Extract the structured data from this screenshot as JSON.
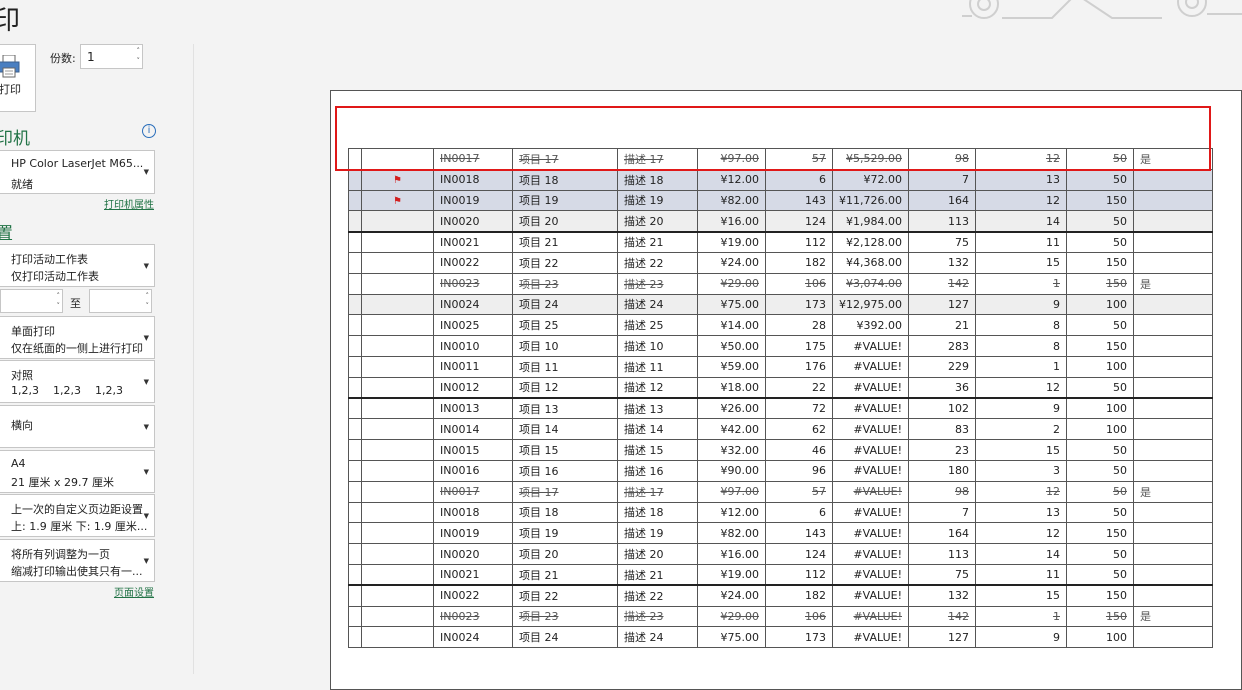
{
  "left": {
    "title": "印",
    "print_button": "打印",
    "copies_label": "份数:",
    "copies_value": "1",
    "printer_section": "印机",
    "printer_name": "HP Color LaserJet M65...",
    "printer_status": "就绪",
    "printer_props": "打印机属性",
    "settings_section": "置",
    "dd_scope_1": "打印活动工作表",
    "dd_scope_2": "仅打印活动工作表",
    "pages_to": "至",
    "dd_sides_1": "单面打印",
    "dd_sides_2": "仅在纸面的一侧上进行打印",
    "dd_collate_1": "对照",
    "dd_collate_2": "1,2,3    1,2,3    1,2,3",
    "dd_orient_1": "横向",
    "dd_paper_1": "A4",
    "dd_paper_2": "21 厘米 x 29.7 厘米",
    "dd_margin_1": "上一次的自定义页边距设置",
    "dd_margin_2": "上: 1.9 厘米 下: 1.9 厘米...",
    "dd_scale_1": "将所有列调整为一页",
    "dd_scale_2": "缩减打印输出使其只有一...",
    "page_setup": "页面设置"
  },
  "colors": {
    "accent": "#217346",
    "selection": "#d6dae6",
    "highlight_box": "#e01818",
    "flag": "#d21f1f"
  },
  "rows": [
    {
      "id": "IN0017",
      "name": "项目 17",
      "desc": "描述 17",
      "price": "¥97.00",
      "qty": "57",
      "total": "¥5,529.00",
      "c8": "98",
      "c9": "12",
      "c10": "50",
      "c11": "是",
      "style": "strike"
    },
    {
      "id": "IN0018",
      "name": "项目 18",
      "desc": "描述 18",
      "price": "¥12.00",
      "qty": "6",
      "total": "¥72.00",
      "c8": "7",
      "c9": "13",
      "c10": "50",
      "c11": "",
      "style": "sel",
      "flag": true
    },
    {
      "id": "IN0019",
      "name": "项目 19",
      "desc": "描述 19",
      "price": "¥82.00",
      "qty": "143",
      "total": "¥11,726.00",
      "c8": "164",
      "c9": "12",
      "c10": "150",
      "c11": "",
      "style": "sel",
      "flag": true
    },
    {
      "id": "IN0020",
      "name": "项目 20",
      "desc": "描述 20",
      "price": "¥16.00",
      "qty": "124",
      "total": "¥1,984.00",
      "c8": "113",
      "c9": "14",
      "c10": "50",
      "c11": "",
      "style": "gray"
    },
    {
      "id": "IN0021",
      "name": "项目 21",
      "desc": "描述 21",
      "price": "¥19.00",
      "qty": "112",
      "total": "¥2,128.00",
      "c8": "75",
      "c9": "11",
      "c10": "50",
      "c11": "",
      "style": "thick"
    },
    {
      "id": "IN0022",
      "name": "项目 22",
      "desc": "描述 22",
      "price": "¥24.00",
      "qty": "182",
      "total": "¥4,368.00",
      "c8": "132",
      "c9": "15",
      "c10": "150",
      "c11": "",
      "style": ""
    },
    {
      "id": "IN0023",
      "name": "项目 23",
      "desc": "描述 23",
      "price": "¥29.00",
      "qty": "106",
      "total": "¥3,074.00",
      "c8": "142",
      "c9": "1",
      "c10": "150",
      "c11": "是",
      "style": "strike"
    },
    {
      "id": "IN0024",
      "name": "项目 24",
      "desc": "描述 24",
      "price": "¥75.00",
      "qty": "173",
      "total": "¥12,975.00",
      "c8": "127",
      "c9": "9",
      "c10": "100",
      "c11": "",
      "style": "gray"
    },
    {
      "id": "IN0025",
      "name": "项目 25",
      "desc": "描述 25",
      "price": "¥14.00",
      "qty": "28",
      "total": "¥392.00",
      "c8": "21",
      "c9": "8",
      "c10": "50",
      "c11": "",
      "style": ""
    },
    {
      "id": "IN0010",
      "name": "项目 10",
      "desc": "描述 10",
      "price": "¥50.00",
      "qty": "175",
      "total": "#VALUE!",
      "c8": "283",
      "c9": "8",
      "c10": "150",
      "c11": "",
      "style": ""
    },
    {
      "id": "IN0011",
      "name": "项目 11",
      "desc": "描述 11",
      "price": "¥59.00",
      "qty": "176",
      "total": "#VALUE!",
      "c8": "229",
      "c9": "1",
      "c10": "100",
      "c11": "",
      "style": ""
    },
    {
      "id": "IN0012",
      "name": "项目 12",
      "desc": "描述 12",
      "price": "¥18.00",
      "qty": "22",
      "total": "#VALUE!",
      "c8": "36",
      "c9": "12",
      "c10": "50",
      "c11": "",
      "style": ""
    },
    {
      "id": "IN0013",
      "name": "项目 13",
      "desc": "描述 13",
      "price": "¥26.00",
      "qty": "72",
      "total": "#VALUE!",
      "c8": "102",
      "c9": "9",
      "c10": "100",
      "c11": "",
      "style": "thick"
    },
    {
      "id": "IN0014",
      "name": "项目 14",
      "desc": "描述 14",
      "price": "¥42.00",
      "qty": "62",
      "total": "#VALUE!",
      "c8": "83",
      "c9": "2",
      "c10": "100",
      "c11": "",
      "style": ""
    },
    {
      "id": "IN0015",
      "name": "项目 15",
      "desc": "描述 15",
      "price": "¥32.00",
      "qty": "46",
      "total": "#VALUE!",
      "c8": "23",
      "c9": "15",
      "c10": "50",
      "c11": "",
      "style": ""
    },
    {
      "id": "IN0016",
      "name": "项目 16",
      "desc": "描述 16",
      "price": "¥90.00",
      "qty": "96",
      "total": "#VALUE!",
      "c8": "180",
      "c9": "3",
      "c10": "50",
      "c11": "",
      "style": ""
    },
    {
      "id": "IN0017",
      "name": "项目 17",
      "desc": "描述 17",
      "price": "¥97.00",
      "qty": "57",
      "total": "#VALUE!",
      "c8": "98",
      "c9": "12",
      "c10": "50",
      "c11": "是",
      "style": "strike"
    },
    {
      "id": "IN0018",
      "name": "项目 18",
      "desc": "描述 18",
      "price": "¥12.00",
      "qty": "6",
      "total": "#VALUE!",
      "c8": "7",
      "c9": "13",
      "c10": "50",
      "c11": "",
      "style": ""
    },
    {
      "id": "IN0019",
      "name": "项目 19",
      "desc": "描述 19",
      "price": "¥82.00",
      "qty": "143",
      "total": "#VALUE!",
      "c8": "164",
      "c9": "12",
      "c10": "150",
      "c11": "",
      "style": ""
    },
    {
      "id": "IN0020",
      "name": "项目 20",
      "desc": "描述 20",
      "price": "¥16.00",
      "qty": "124",
      "total": "#VALUE!",
      "c8": "113",
      "c9": "14",
      "c10": "50",
      "c11": "",
      "style": ""
    },
    {
      "id": "IN0021",
      "name": "项目 21",
      "desc": "描述 21",
      "price": "¥19.00",
      "qty": "112",
      "total": "#VALUE!",
      "c8": "75",
      "c9": "11",
      "c10": "50",
      "c11": "",
      "style": ""
    },
    {
      "id": "IN0022",
      "name": "项目 22",
      "desc": "描述 22",
      "price": "¥24.00",
      "qty": "182",
      "total": "#VALUE!",
      "c8": "132",
      "c9": "15",
      "c10": "150",
      "c11": "",
      "style": "thick"
    },
    {
      "id": "IN0023",
      "name": "项目 23",
      "desc": "描述 23",
      "price": "¥29.00",
      "qty": "106",
      "total": "#VALUE!",
      "c8": "142",
      "c9": "1",
      "c10": "150",
      "c11": "是",
      "style": "strike"
    },
    {
      "id": "IN0024",
      "name": "项目 24",
      "desc": "描述 24",
      "price": "¥75.00",
      "qty": "173",
      "total": "#VALUE!",
      "c8": "127",
      "c9": "9",
      "c10": "100",
      "c11": "",
      "style": ""
    }
  ]
}
